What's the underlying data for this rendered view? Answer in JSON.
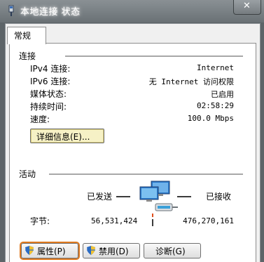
{
  "window": {
    "title": "本地连接 状态",
    "close_glyph": "✕"
  },
  "tabs": [
    {
      "label": "常规"
    }
  ],
  "connection": {
    "header": "连接",
    "rows": [
      {
        "label": "IPv4 连接:",
        "value": "Internet"
      },
      {
        "label": "IPv6 连接:",
        "value": "无 Internet 访问权限"
      },
      {
        "label": "媒体状态:",
        "value": "已启用"
      },
      {
        "label": "持续时间:",
        "value": "02:58:29"
      },
      {
        "label": "速度:",
        "value": "100.0 Mbps"
      }
    ],
    "details_button": "详细信息(E)..."
  },
  "activity": {
    "header": "活动",
    "sent_label": "已发送",
    "received_label": "已接收",
    "bytes_label": "字节:",
    "bytes_sent": "56,531,424",
    "bytes_received": "476,270,161"
  },
  "buttons": {
    "properties": "属性(P)",
    "disable": "禁用(D)",
    "diagnose": "诊断(G)"
  },
  "colors": {
    "focus_ring": "#e07a1f",
    "details_bg": "#f6f1c6",
    "titlebar": "#7a8084"
  }
}
